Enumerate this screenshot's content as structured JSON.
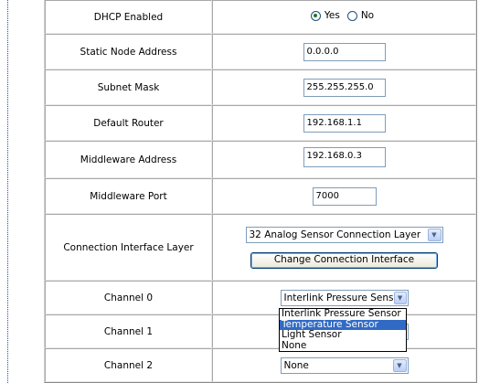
{
  "form": {
    "dhcp": {
      "label": "DHCP Enabled",
      "options": [
        "Yes",
        "No"
      ],
      "selected": "Yes"
    },
    "static_node": {
      "label": "Static Node Address",
      "value": "0.0.0.0"
    },
    "subnet": {
      "label": "Subnet Mask",
      "value": "255.255.255.0"
    },
    "router": {
      "label": "Default Router",
      "value": "192.168.1.1"
    },
    "mw_address": {
      "label": "Middleware Address",
      "value": "192.168.0.3"
    },
    "mw_port": {
      "label": "Middleware Port",
      "value": "7000"
    },
    "connection": {
      "label": "Connection Interface Layer",
      "selected": "32 Analog Sensor Connection Layer",
      "button": "Change Connection Interface"
    },
    "channels": [
      {
        "label": "Channel 0",
        "selected": "Interlink Pressure Sensor"
      },
      {
        "label": "Channel 1",
        "selected": ""
      },
      {
        "label": "Channel 2",
        "selected": "None"
      }
    ],
    "dropdown_open": {
      "options": [
        "Interlink Pressure Sensor",
        "Temperature Sensor",
        "Light Sensor",
        "None"
      ],
      "highlighted": "Temperature Sensor"
    }
  },
  "colors": {
    "highlight": "#316ac5",
    "textbox_border": "#7f9db9",
    "radio_dot": "#1f7a1f"
  },
  "icons": {
    "dropdown_arrow": "chevron-down-icon",
    "radio": "radio-icon"
  }
}
